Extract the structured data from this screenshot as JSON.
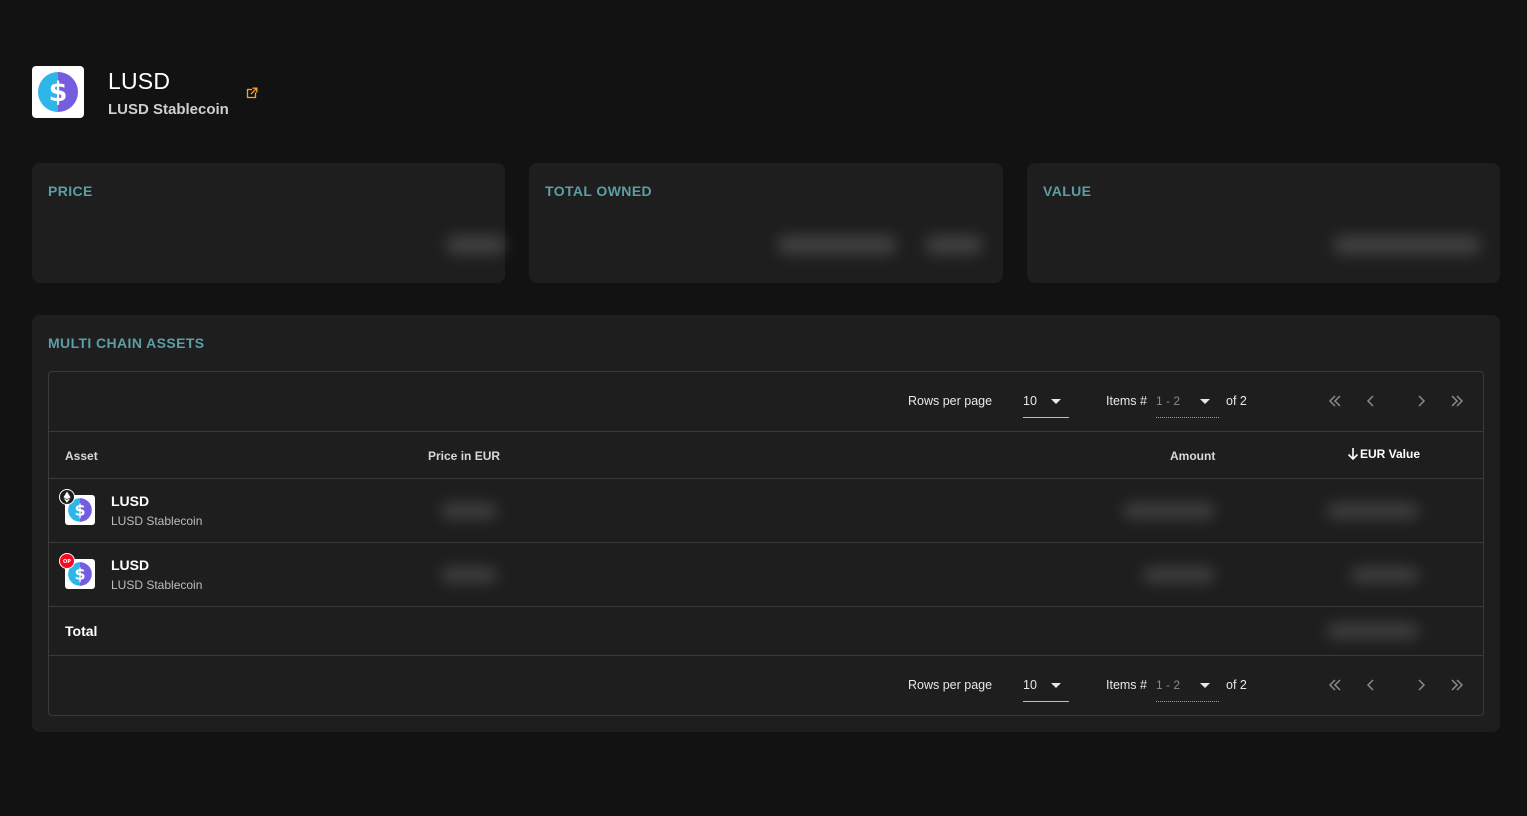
{
  "header": {
    "symbol": "LUSD",
    "name": "LUSD Stablecoin",
    "logo_icon": "lusd-logo",
    "external_link_icon": "external-link-icon"
  },
  "stats": {
    "price_label": "PRICE",
    "total_owned_label": "TOTAL OWNED",
    "value_label": "VALUE"
  },
  "section": {
    "title": "MULTI CHAIN ASSETS"
  },
  "pagination": {
    "rows_per_page_label": "Rows per page",
    "rows_per_page_value": "10",
    "items_label": "Items #",
    "items_range": "1 - 2",
    "of_label": "of 2"
  },
  "table": {
    "columns": {
      "asset": "Asset",
      "price": "Price in EUR",
      "amount": "Amount",
      "eur_value": "EUR Value"
    },
    "sort": {
      "column": "eur_value",
      "direction": "descending"
    },
    "rows": [
      {
        "symbol": "LUSD",
        "name": "LUSD Stablecoin",
        "chain_icon": "ethereum-icon"
      },
      {
        "symbol": "LUSD",
        "name": "LUSD Stablecoin",
        "chain_icon": "optimism-icon"
      }
    ],
    "total_label": "Total"
  },
  "colors": {
    "background": "#121212",
    "card": "#1e1e1e",
    "label_accent": "#5c9ea4",
    "external_link": "#f5a623",
    "optimism_red": "#ff0420"
  }
}
